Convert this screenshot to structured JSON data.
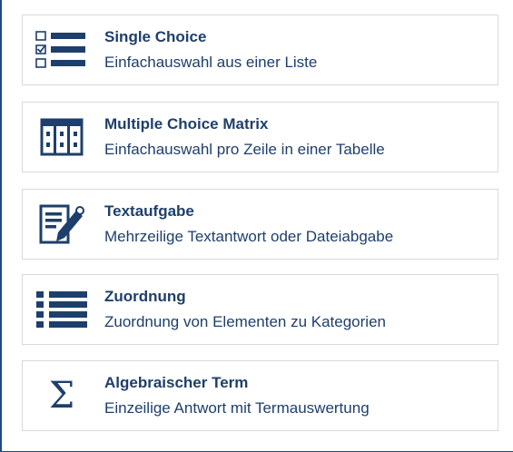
{
  "colors": {
    "accent": "#1e3f6b",
    "border": "#d9d9d9"
  },
  "items": [
    {
      "icon": "single-choice-list-icon",
      "title": "Single Choice",
      "description": "Einfachauswahl aus einer Liste"
    },
    {
      "icon": "matrix-table-icon",
      "title": "Multiple Choice Matrix",
      "description": "Einfachauswahl pro Zeile in einer Tabelle"
    },
    {
      "icon": "text-edit-icon",
      "title": "Textaufgabe",
      "description": "Mehrzeilige Textantwort oder Dateiabgabe"
    },
    {
      "icon": "list-icon",
      "title": "Zuordnung",
      "description": "Zuordnung von Elementen zu Kategorien"
    },
    {
      "icon": "sigma-icon",
      "title": "Algebraischer Term",
      "description": "Einzeilige Antwort mit Termauswertung"
    }
  ]
}
